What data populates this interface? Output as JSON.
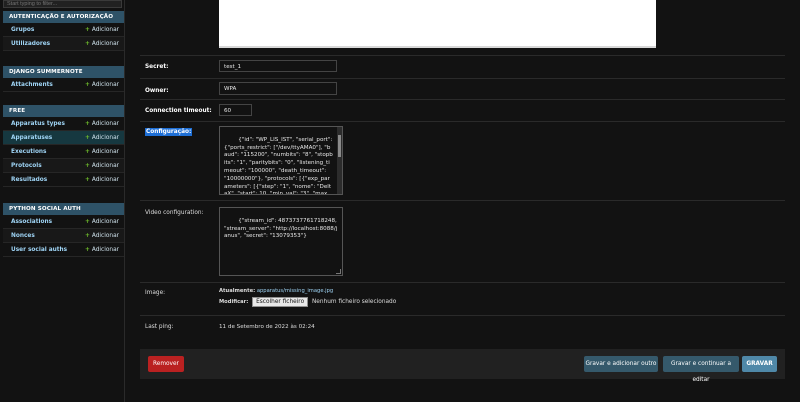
{
  "sidebar": {
    "filter_placeholder": "Start typing to filter...",
    "modules": [
      {
        "caption": "AUTENTICAÇÃO E AUTORIZAÇÃO",
        "rows": [
          {
            "label": "Grupos",
            "add": "Adicionar"
          },
          {
            "label": "Utilizadores",
            "add": "Adicionar"
          }
        ]
      },
      {
        "caption": "DJANGO SUMMERNOTE",
        "rows": [
          {
            "label": "Attachments",
            "add": "Adicionar"
          }
        ]
      },
      {
        "caption": "FREE",
        "rows": [
          {
            "label": "Apparatus types",
            "add": "Adicionar"
          },
          {
            "label": "Apparatuses",
            "add": "Adicionar"
          },
          {
            "label": "Executions",
            "add": "Adicionar"
          },
          {
            "label": "Protocols",
            "add": "Adicionar"
          },
          {
            "label": "Resultados",
            "add": "Adicionar"
          }
        ]
      },
      {
        "caption": "PYTHON SOCIAL AUTH",
        "rows": [
          {
            "label": "Associations",
            "add": "Adicionar"
          },
          {
            "label": "Nonces",
            "add": "Adicionar"
          },
          {
            "label": "User social auths",
            "add": "Adicionar"
          }
        ]
      }
    ]
  },
  "form": {
    "secret": {
      "label": "Secret:",
      "value": "test_1"
    },
    "owner": {
      "label": "Owner:",
      "value": "WPA"
    },
    "timeout": {
      "label": "Connection timeout:",
      "value": "60"
    },
    "config": {
      "label": "Configuração:",
      "value": "{\"id\": \"WP_LIS_IST\", \"serial_port\": {\"ports_restrict\": [\"/dev/ttyAMA0\"], \"baud\": \"115200\", \"numbits\": \"8\", \"stopbits\": \"1\", \"paritybits\": \"0\", \"listening_timeout\": \"100000\", \"death_timeout\": \"10000000\"}, \"protocols\": [{\"exp_parameters\": [{\"step\": \"1\", \"nome\": \"DeltaX\", \"start\": 10, \"min_val\": \"3\", \"max_val\": \"22\"}, {\"step\": \"1\", \"nome\": \"Samples\", \"start\": 50, \"min_val\": \"2\", \"max_val\": \"250\"}], \"measurement_channels\":"
    },
    "video": {
      "label": "Video configuration:",
      "value": "{\"stream_id\": 4873737761718248, \"stream_server\": \"http://localhost:8088/janus\", \"secret\": \"13079353\"}"
    },
    "image": {
      "label": "Image:",
      "current_label": "Atualmente:",
      "current_value": "apparatus/missing_image.jpg",
      "change_label": "Modificar:",
      "choose_button": "Escolher ficheiro",
      "no_file": "Nenhum ficheiro selecionado"
    },
    "last_ping": {
      "label": "Last ping:",
      "value": "11 de Setembro de 2022 às 02:24"
    }
  },
  "submit": {
    "delete": "Remover",
    "save_add": "Gravar e adicionar outro",
    "save_continue": "Gravar e continuar a editar",
    "save": "GRAVAR"
  }
}
